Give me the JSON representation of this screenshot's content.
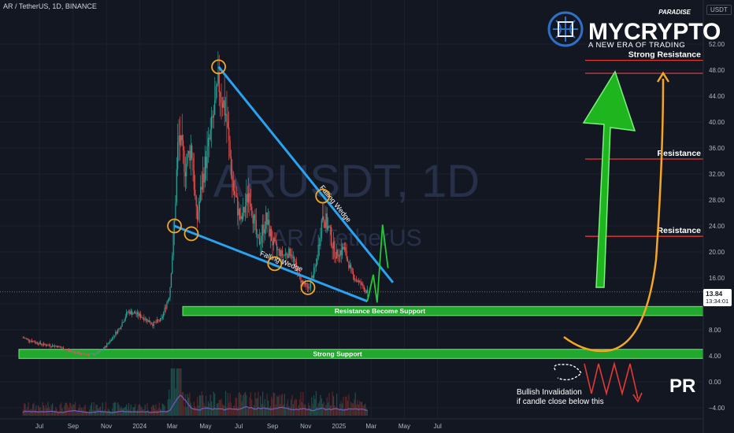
{
  "header": {
    "symbol_line": "AR / TetherUS, 1D, BINANCE"
  },
  "watermark": {
    "ticker": "ARUSDT, 1D",
    "name": "AR / TetherUS"
  },
  "logo": {
    "brand": "MYCRYPTO",
    "tag": "PARADISE",
    "tagline": "A NEW ERA OF TRADING"
  },
  "price_axis": {
    "currency": "USDT",
    "last_price": "13.84",
    "countdown": "13:34:01"
  },
  "pr_badge": "PR",
  "colors": {
    "background": "#131722",
    "bull": "#26a69a",
    "bear": "#ef5350",
    "zone": "#22b02e",
    "wedge": "#29a3f0",
    "resistance": "#e53935",
    "arc": "#f5a623",
    "grid": "#1e222d",
    "volume_ma": "#7e57c2"
  },
  "chart_data": {
    "type": "candlestick",
    "title": "AR / TetherUS, 1D, BINANCE",
    "ylim": [
      -4,
      54
    ],
    "y_scale": "linear",
    "y_ticks": [
      52,
      48,
      44,
      40,
      36,
      32,
      28,
      24,
      20,
      16,
      12,
      8,
      4,
      0,
      -4
    ],
    "y_tick_labels": [
      "52.00",
      "48.00",
      "44.00",
      "40.00",
      "36.00",
      "32.00",
      "28.00",
      "24.00",
      "20.00",
      "16.00",
      "12.00",
      "8.00",
      "4.00",
      "0.00",
      "−4.00"
    ],
    "x_tick_labels": [
      {
        "label": "Jul",
        "date": "2023-07-01"
      },
      {
        "label": "Sep",
        "date": "2023-09-01"
      },
      {
        "label": "Nov",
        "date": "2023-11-01"
      },
      {
        "label": "2024",
        "date": "2024-01-01"
      },
      {
        "label": "Mar",
        "date": "2024-03-01"
      },
      {
        "label": "May",
        "date": "2024-05-01"
      },
      {
        "label": "Jul",
        "date": "2024-07-01"
      },
      {
        "label": "Sep",
        "date": "2024-09-01"
      },
      {
        "label": "Nov",
        "date": "2024-11-01"
      },
      {
        "label": "2025",
        "date": "2025-01-01"
      },
      {
        "label": "Mar",
        "date": "2025-03-01"
      },
      {
        "label": "May",
        "date": "2025-05-01"
      },
      {
        "label": "Jul",
        "date": "2025-07-01"
      }
    ],
    "grid": true,
    "price_path": [
      {
        "date": "2023-06-01",
        "price": 6.8
      },
      {
        "date": "2023-06-20",
        "price": 6.2
      },
      {
        "date": "2023-07-10",
        "price": 5.7
      },
      {
        "date": "2023-08-01",
        "price": 5.5
      },
      {
        "date": "2023-08-25",
        "price": 4.8
      },
      {
        "date": "2023-09-15",
        "price": 4.3
      },
      {
        "date": "2023-10-10",
        "price": 4.2
      },
      {
        "date": "2023-10-25",
        "price": 4.9
      },
      {
        "date": "2023-11-10",
        "price": 6.6
      },
      {
        "date": "2023-11-25",
        "price": 8.3
      },
      {
        "date": "2023-12-10",
        "price": 10.8
      },
      {
        "date": "2023-12-25",
        "price": 10.5
      },
      {
        "date": "2024-01-10",
        "price": 9.8
      },
      {
        "date": "2024-01-25",
        "price": 8.9
      },
      {
        "date": "2024-02-10",
        "price": 9.6
      },
      {
        "date": "2024-02-25",
        "price": 13.5
      },
      {
        "date": "2024-03-05",
        "price": 24.5
      },
      {
        "date": "2024-03-12",
        "price": 38.0
      },
      {
        "date": "2024-03-25",
        "price": 33.0
      },
      {
        "date": "2024-04-05",
        "price": 36.5
      },
      {
        "date": "2024-04-15",
        "price": 24.5
      },
      {
        "date": "2024-04-25",
        "price": 31.0
      },
      {
        "date": "2024-05-10",
        "price": 38.0
      },
      {
        "date": "2024-05-25",
        "price": 46.0
      },
      {
        "date": "2024-06-08",
        "price": 41.0
      },
      {
        "date": "2024-06-20",
        "price": 30.0
      },
      {
        "date": "2024-07-05",
        "price": 24.5
      },
      {
        "date": "2024-07-20",
        "price": 29.5
      },
      {
        "date": "2024-08-05",
        "price": 21.0
      },
      {
        "date": "2024-08-20",
        "price": 25.0
      },
      {
        "date": "2024-09-05",
        "price": 20.5
      },
      {
        "date": "2024-09-20",
        "price": 19.5
      },
      {
        "date": "2024-10-05",
        "price": 20.0
      },
      {
        "date": "2024-10-20",
        "price": 16.0
      },
      {
        "date": "2024-11-05",
        "price": 14.2
      },
      {
        "date": "2024-11-20",
        "price": 18.0
      },
      {
        "date": "2024-12-02",
        "price": 26.0
      },
      {
        "date": "2024-12-15",
        "price": 23.0
      },
      {
        "date": "2024-12-25",
        "price": 19.5
      },
      {
        "date": "2025-01-10",
        "price": 20.5
      },
      {
        "date": "2025-01-25",
        "price": 16.5
      },
      {
        "date": "2025-02-10",
        "price": 15.0
      },
      {
        "date": "2025-02-22",
        "price": 13.84
      }
    ],
    "levels": [
      {
        "label": "Strong Resistance",
        "price": 49.5
      },
      {
        "label": "",
        "price": 47.5
      },
      {
        "label": "Resistance",
        "price": 34.3
      },
      {
        "label": "Resistance",
        "price": 22.4
      }
    ],
    "zones": [
      {
        "label": "Resistance Become Support",
        "top": 11.6,
        "bottom": 10.2
      },
      {
        "label": "Strong Support",
        "top": 5.0,
        "bottom": 3.6
      }
    ],
    "wedge": {
      "label": "Falling Wedge",
      "upper": [
        {
          "date": "2024-05-25",
          "price": 48.5
        },
        {
          "date": "2025-04-10",
          "price": 15.3
        }
      ],
      "lower": [
        {
          "date": "2024-03-05",
          "price": 24.0
        },
        {
          "date": "2025-02-22",
          "price": 12.4
        }
      ],
      "touches": [
        {
          "date": "2024-05-25",
          "price": 48.5
        },
        {
          "date": "2024-12-02",
          "price": 28.6
        },
        {
          "date": "2024-03-05",
          "price": 24.0
        },
        {
          "date": "2024-04-05",
          "price": 22.8
        },
        {
          "date": "2024-09-05",
          "price": 18.2
        },
        {
          "date": "2024-11-05",
          "price": 14.5
        }
      ]
    },
    "projection": [
      {
        "date": "2025-02-22",
        "price": 12.4
      },
      {
        "date": "2025-03-05",
        "price": 16.5
      },
      {
        "date": "2025-03-12",
        "price": 12.2
      },
      {
        "date": "2025-03-22",
        "price": 24.2
      },
      {
        "date": "2025-04-01",
        "price": 17.5
      }
    ],
    "annotations": [
      {
        "text": "Bullish Invalidation",
        "date": "2025-01-05",
        "price": -1
      },
      {
        "text": "if candle close below this",
        "date": "2025-01-05",
        "price": -2.5
      }
    ]
  }
}
